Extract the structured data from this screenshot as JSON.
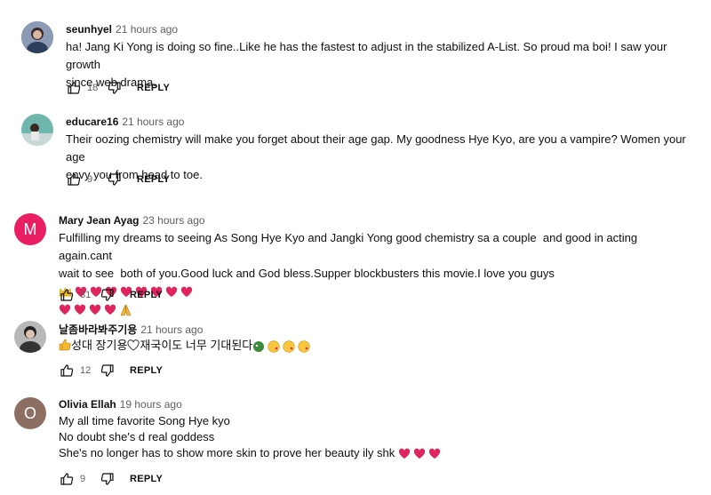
{
  "comments": [
    {
      "author": "seunhyel",
      "time": "21 hours ago",
      "lines": [
        "ha! Jang Ki Yong is doing so fine..Like he has the fastest to adjust in the stabilized A-List. So proud ma boi! I saw your growth",
        "since web drama."
      ],
      "likes": "18",
      "reply": "REPLY",
      "avatar_color": "#6a7a9a"
    },
    {
      "author": "educare16",
      "time": "21 hours ago",
      "lines": [
        "Their oozing chemistry will make you forget about their age gap. My goodness Hye Kyo, are you a vampire? Women your age",
        "envy you from head to toe."
      ],
      "likes": "9",
      "reply": "REPLY",
      "avatar_color": "#5fa8a0"
    },
    {
      "author": "Mary Jean Ayag",
      "time": "23 hours ago",
      "avatar_letter": "M",
      "lines": [
        "Fulfilling my dreams to seeing As Song Hye Kyo and Jangki Yong good chemistry sa a couple  and good in acting again.cant",
        "wait to see  both of you.Good luck and God bless.Supper blockbusters this movie.I love you guys"
      ],
      "likes": "31",
      "reply": "REPLY",
      "avatar_color": "#e91e63"
    },
    {
      "author": "날좀바라봐주기용",
      "time": "21 hours ago",
      "line": "성대 장기용",
      "line2": "재국이도 너무 기대된다",
      "likes": "12",
      "reply": "REPLY",
      "avatar_color": "#7a7a7a"
    },
    {
      "author": "Olivia Ellah",
      "time": "19 hours ago",
      "avatar_letter": "O",
      "lines": [
        "My all time favorite Song Hye kyo",
        "No doubt she's d real goddess",
        "She's no longer has to show more skin to prove her beauty ily shk"
      ],
      "likes": "9",
      "reply": "REPLY",
      "avatar_color": "#8d6e63"
    }
  ],
  "colors": {
    "heart": "#e0245e",
    "text_secondary": "#606060"
  }
}
